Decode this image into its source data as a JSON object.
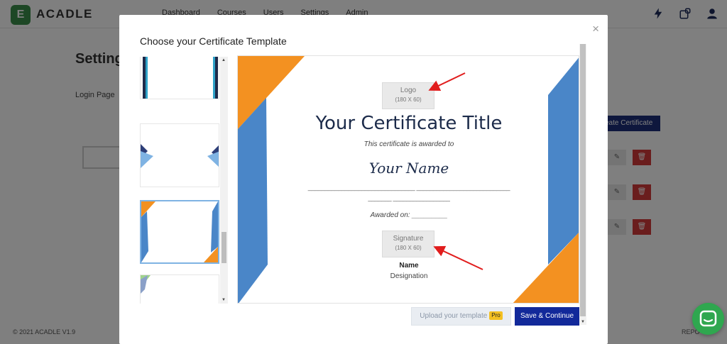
{
  "app": {
    "brand": "ACADLE",
    "logo_letter": "E",
    "nav": [
      "Dashboard",
      "Courses",
      "Users",
      "Settings",
      "Admin"
    ],
    "page_title": "Settings",
    "section": "Login Page",
    "create_button": "eate Certificate",
    "footer_left": "© 2021 ACADLE V1.9",
    "footer_right": "REPO"
  },
  "modal": {
    "title": "Choose your Certificate Template",
    "close_symbol": "×",
    "selected_template_index": 2,
    "preview": {
      "logo_label": "Logo",
      "logo_size": "(180 X 60)",
      "title": "Your Certificate Title",
      "awarded_to": "This certificate is awarded to",
      "name": "Your Name",
      "description_line1": "________________________________ ____________________________",
      "description_line2": "_______ _________________",
      "awarded_on": "Awarded on: _________",
      "signature_label": "Signature",
      "signature_size": "(180 X 60)",
      "signer_name": "Name",
      "signer_designation": "Designation"
    },
    "upload_button": "Upload your template",
    "pro_badge": "Pro",
    "save_button": "Save & Continue"
  },
  "colors": {
    "accent_blue": "#4a86c8",
    "accent_orange": "#f39121",
    "primary_button": "#12299a",
    "chat_green": "#2fa74f"
  },
  "icons": {
    "bolt": "lightning-icon",
    "apps": "app-switch-icon",
    "user": "user-icon",
    "chat": "chat-icon"
  }
}
